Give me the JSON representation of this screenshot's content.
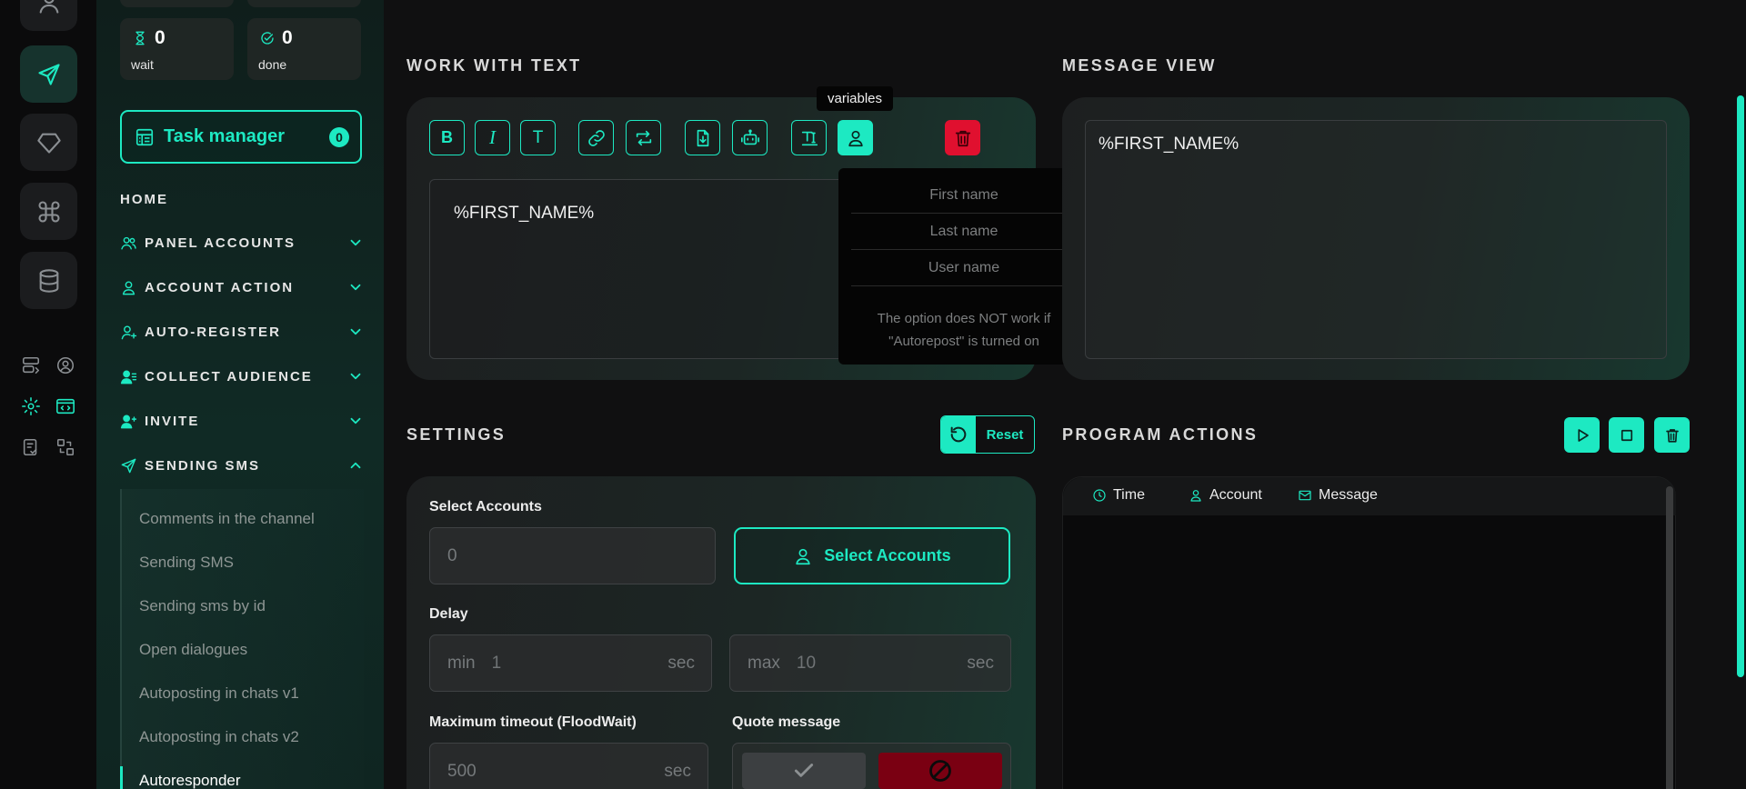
{
  "sidebar": {
    "stats": [
      {
        "value": "0",
        "label": "wait",
        "icon": "hourglass-icon"
      },
      {
        "value": "0",
        "label": "done",
        "icon": "check-circle-icon"
      }
    ],
    "task_manager": {
      "label": "Task manager",
      "badge": "0"
    },
    "home": "HOME",
    "nav": [
      {
        "label": "PANEL ACCOUNTS",
        "icon": "users-icon"
      },
      {
        "label": "ACCOUNT ACTION",
        "icon": "user-icon"
      },
      {
        "label": "AUTO-REGISTER",
        "icon": "user-plus-icon"
      },
      {
        "label": "COLLECT AUDIENCE",
        "icon": "user-list-icon"
      },
      {
        "label": "INVITE",
        "icon": "user-invite-icon"
      },
      {
        "label": "SENDING SMS",
        "icon": "paper-plane-icon"
      }
    ],
    "sub": [
      {
        "label": "Comments in the channel"
      },
      {
        "label": "Sending SMS"
      },
      {
        "label": "Sending sms by id"
      },
      {
        "label": "Open dialogues"
      },
      {
        "label": "Autoposting in chats v1"
      },
      {
        "label": "Autoposting in chats v2"
      },
      {
        "label": "Autoresponder"
      }
    ]
  },
  "work_with_text": {
    "title": "WORK WITH TEXT",
    "editor_text": "%FIRST_NAME%",
    "tooltip": "variables",
    "variables": [
      "First name",
      "Last name",
      "User name"
    ],
    "note": "The option does NOT work if \"Autorepost\" is turned on"
  },
  "message_view": {
    "title": "MESSAGE VIEW",
    "text": "%FIRST_NAME%"
  },
  "settings": {
    "title": "SETTINGS",
    "reset_label": "Reset",
    "select_accounts_label": "Select Accounts",
    "accounts_value": "0",
    "select_accounts_button": "Select Accounts",
    "delay_label": "Delay",
    "delay_min_prefix": "min",
    "delay_min": "1",
    "delay_max_prefix": "max",
    "delay_max": "10",
    "unit": "sec",
    "floodwait_label": "Maximum timeout (FloodWait)",
    "floodwait_value": "500",
    "quote_label": "Quote message"
  },
  "program_actions": {
    "title": "PROGRAM ACTIONS",
    "columns": [
      "Time",
      "Account",
      "Message"
    ]
  },
  "colors": {
    "accent": "#1de9c2",
    "danger": "#e0102f",
    "background": "#101011"
  }
}
